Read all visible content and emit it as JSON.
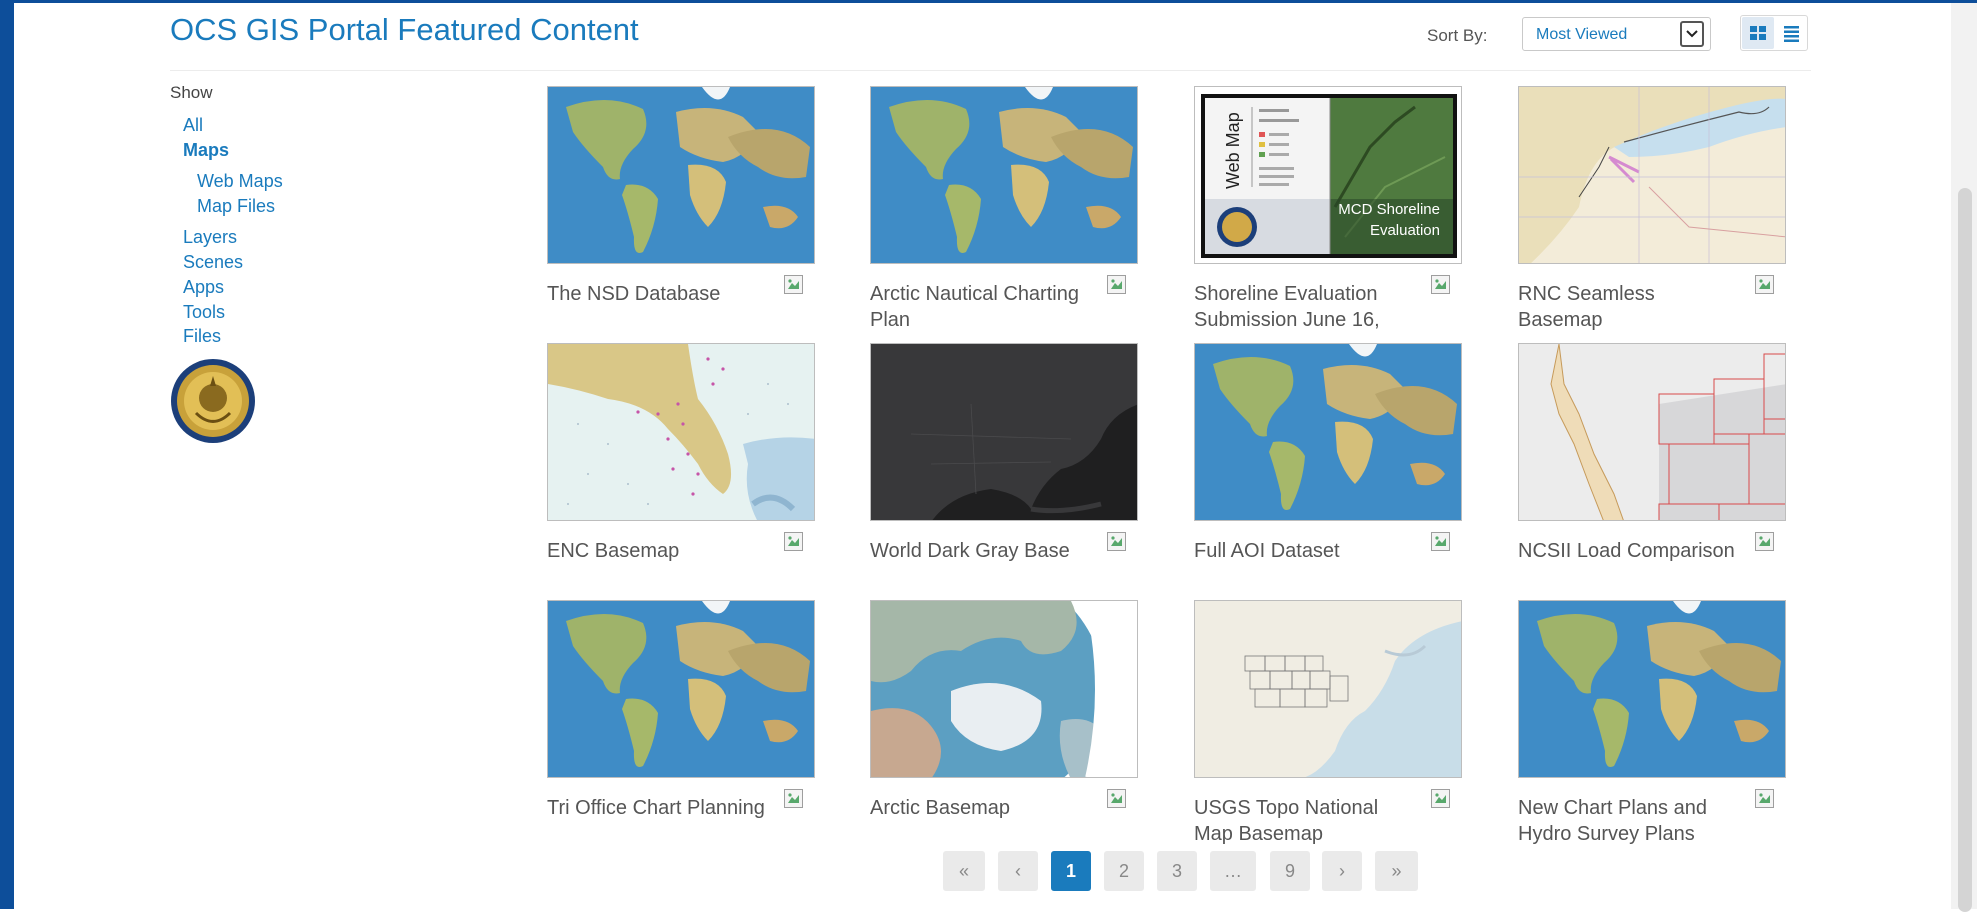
{
  "page": {
    "title": "OCS GIS Portal Featured Content"
  },
  "sort": {
    "label": "Sort By:",
    "value": "Most Viewed"
  },
  "filter": {
    "heading": "Show",
    "items": [
      {
        "label": "All",
        "active": false
      },
      {
        "label": "Maps",
        "active": true
      },
      {
        "label": "Web Maps",
        "active": false
      },
      {
        "label": "Map Files",
        "active": false
      },
      {
        "label": "Layers",
        "active": false
      },
      {
        "label": "Scenes",
        "active": false
      },
      {
        "label": "Apps",
        "active": false
      },
      {
        "label": "Tools",
        "active": false
      },
      {
        "label": "Files",
        "active": false
      }
    ]
  },
  "items": [
    {
      "title": "The NSD Database",
      "thumb": "world-imagery",
      "icon": "map-icon"
    },
    {
      "title": "Arctic Nautical Charting Plan",
      "thumb": "world-imagery",
      "icon": "map-icon"
    },
    {
      "title": "Shoreline Evaluation Submission June 16,",
      "thumb": "web-map-shoreline",
      "icon": "map-icon",
      "thumb_text": {
        "side": "Web Map",
        "banner_1": "MCD Shoreline",
        "banner_2": "Evaluation"
      }
    },
    {
      "title": "RNC Seamless Basemap",
      "thumb": "nautical-chart",
      "icon": "map-icon"
    },
    {
      "title": "ENC Basemap",
      "thumb": "enc-florida",
      "icon": "map-icon"
    },
    {
      "title": "World Dark Gray Base",
      "thumb": "dark-gray",
      "icon": "map-icon"
    },
    {
      "title": "Full AOI Dataset",
      "thumb": "world-imagery",
      "icon": "map-icon"
    },
    {
      "title": "NCSII Load Comparison",
      "thumb": "ncsii-boxes",
      "icon": "map-icon"
    },
    {
      "title": "Tri Office Chart Planning",
      "thumb": "world-imagery",
      "icon": "map-icon"
    },
    {
      "title": "Arctic Basemap",
      "thumb": "arctic-globe",
      "icon": "map-icon"
    },
    {
      "title": "USGS Topo National Map Basemap",
      "thumb": "usgs-topo",
      "icon": "map-icon"
    },
    {
      "title": "New Chart Plans and Hydro Survey Plans",
      "thumb": "world-imagery",
      "icon": "map-icon"
    }
  ],
  "pagination": {
    "first": "«",
    "prev": "‹",
    "pages": [
      "1",
      "2",
      "3",
      "…",
      "9"
    ],
    "current": "1",
    "next": "›",
    "last": "»"
  },
  "colors": {
    "link": "#1a7bbd",
    "frame": "#0d4e9a",
    "pager_active": "#1a7bbd"
  }
}
